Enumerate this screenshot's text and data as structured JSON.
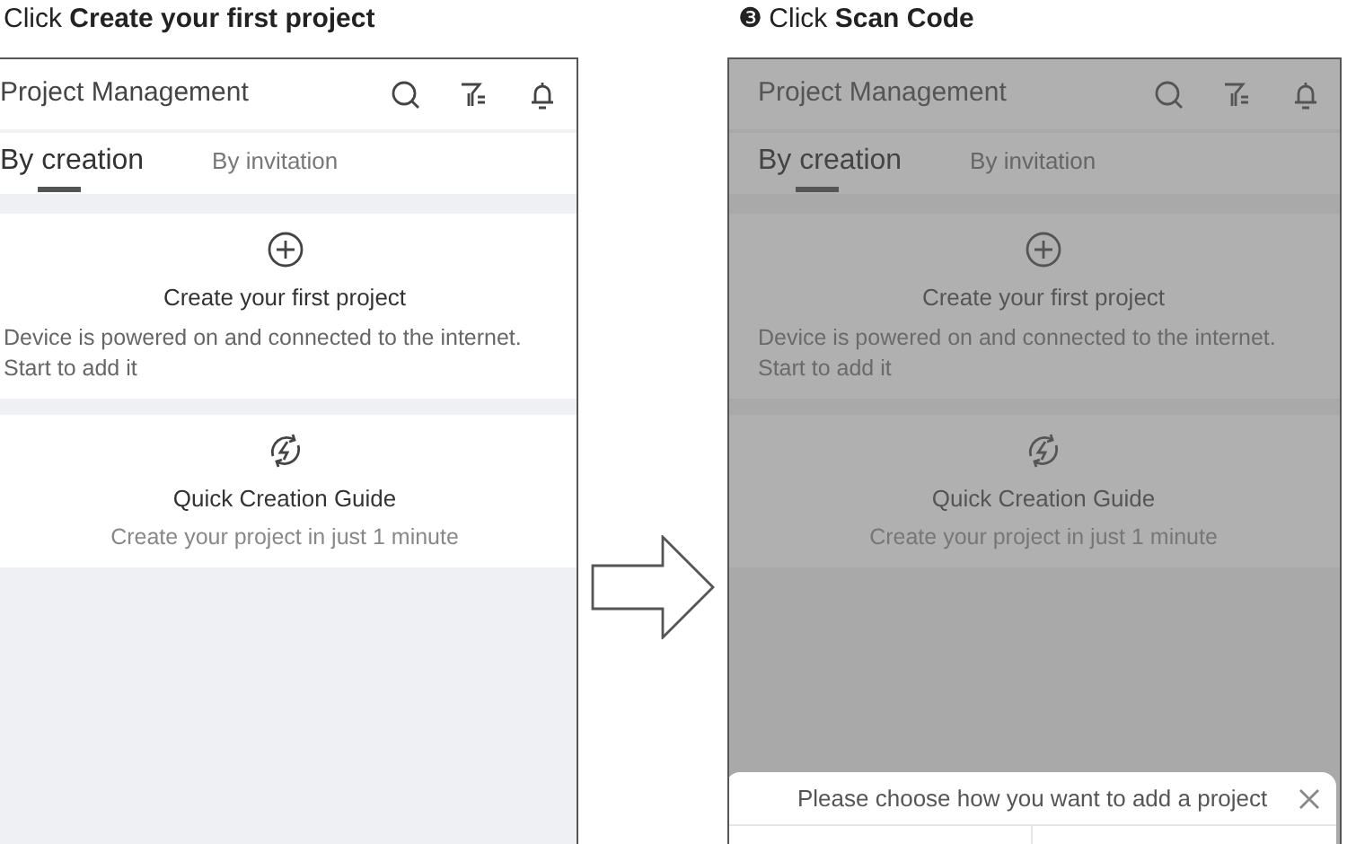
{
  "steps": [
    {
      "heading": "Click **Create your first project**",
      "screen": {
        "dimmed": false,
        "title": "Project Management",
        "tabs": [
          {
            "label": "By creation",
            "selected": true
          },
          {
            "label": "By invitation",
            "selected": false
          }
        ],
        "cards": [
          {
            "kind": "create",
            "title": "Create your first project",
            "description": "Device is powered on and connected to the internet. Start to add it"
          },
          {
            "kind": "guide",
            "title": "Quick Creation Guide",
            "description": "Create your project in just 1 minute"
          }
        ]
      }
    },
    {
      "heading": "❸ Click **Scan Code**",
      "screen": {
        "dimmed": true,
        "title": "Project Management",
        "tabs": [
          {
            "label": "By creation",
            "selected": true
          },
          {
            "label": "By invitation",
            "selected": false
          }
        ],
        "cards": [
          {
            "kind": "create",
            "title": "Create your first project",
            "description": "Device is powered on and connected to the internet. Start to add it"
          },
          {
            "kind": "guide",
            "title": "Quick Creation Guide",
            "description": "Create your project in just 1 minute"
          }
        ],
        "sheet": {
          "title": "Please choose how you want to add a project"
        }
      }
    }
  ]
}
